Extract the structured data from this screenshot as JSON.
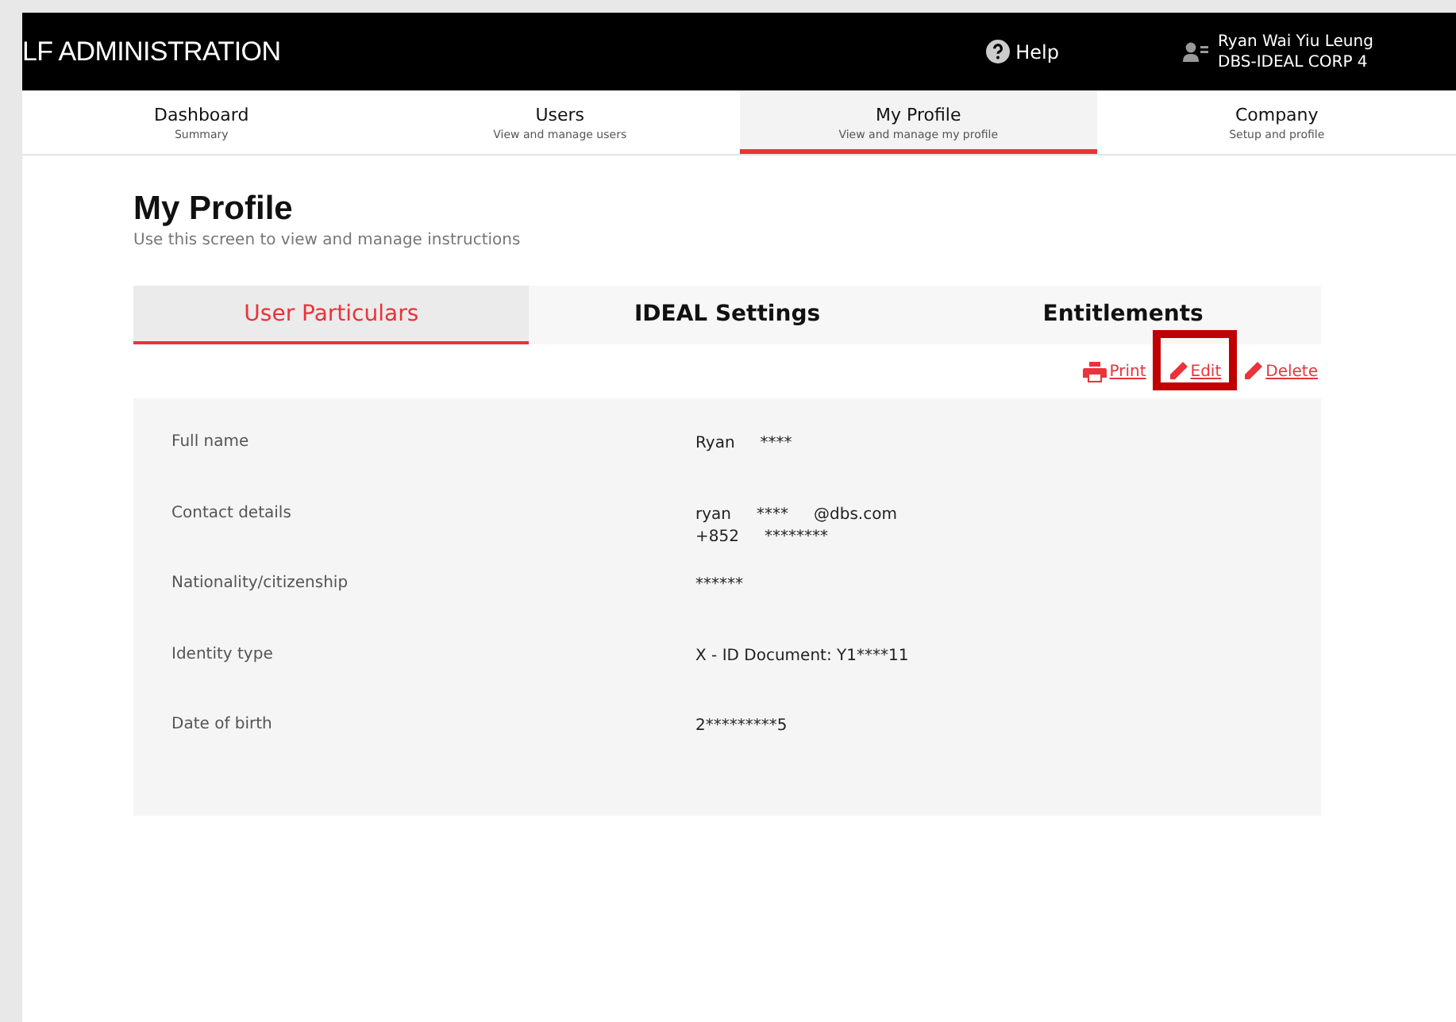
{
  "header": {
    "title": "LF ADMINISTRATION",
    "help": "Help",
    "user_name": "Ryan Wai Yiu Leung",
    "company": "DBS-IDEAL CORP 4"
  },
  "nav": [
    {
      "label": "Dashboard",
      "sub": "Summary",
      "selected": false
    },
    {
      "label": "Users",
      "sub": "View and manage users",
      "selected": false
    },
    {
      "label": "My Profile",
      "sub": "View and manage my profile",
      "selected": true
    },
    {
      "label": "Company",
      "sub": "Setup and profile",
      "selected": false
    }
  ],
  "page": {
    "title": "My Profile",
    "subtitle": "Use this screen to view and manage instructions"
  },
  "tabs": [
    {
      "label": "User Particulars",
      "selected": true
    },
    {
      "label": "IDEAL Settings",
      "selected": false
    },
    {
      "label": "Entitlements",
      "selected": false
    }
  ],
  "actions": [
    {
      "kind": "print",
      "label": "Print",
      "highlighted": false
    },
    {
      "kind": "edit",
      "label": "Edit",
      "highlighted": true
    },
    {
      "kind": "edit",
      "label": "Delete",
      "highlighted": false
    }
  ],
  "fields": [
    {
      "label": "Full name",
      "lines": [
        [
          "Ryan",
          "****"
        ]
      ]
    },
    {
      "label": "Contact details",
      "lines": [
        [
          "ryan",
          "****",
          "@dbs.com"
        ],
        [
          "+852",
          "********"
        ]
      ]
    },
    {
      "label": "Nationality/citizenship",
      "lines": [
        [
          "******"
        ]
      ]
    },
    {
      "label": "Identity type",
      "lines": [
        [
          "X - ID Document: Y1****11"
        ]
      ]
    },
    {
      "label": "Date of birth",
      "lines": [
        [
          "2*********5"
        ]
      ]
    }
  ]
}
